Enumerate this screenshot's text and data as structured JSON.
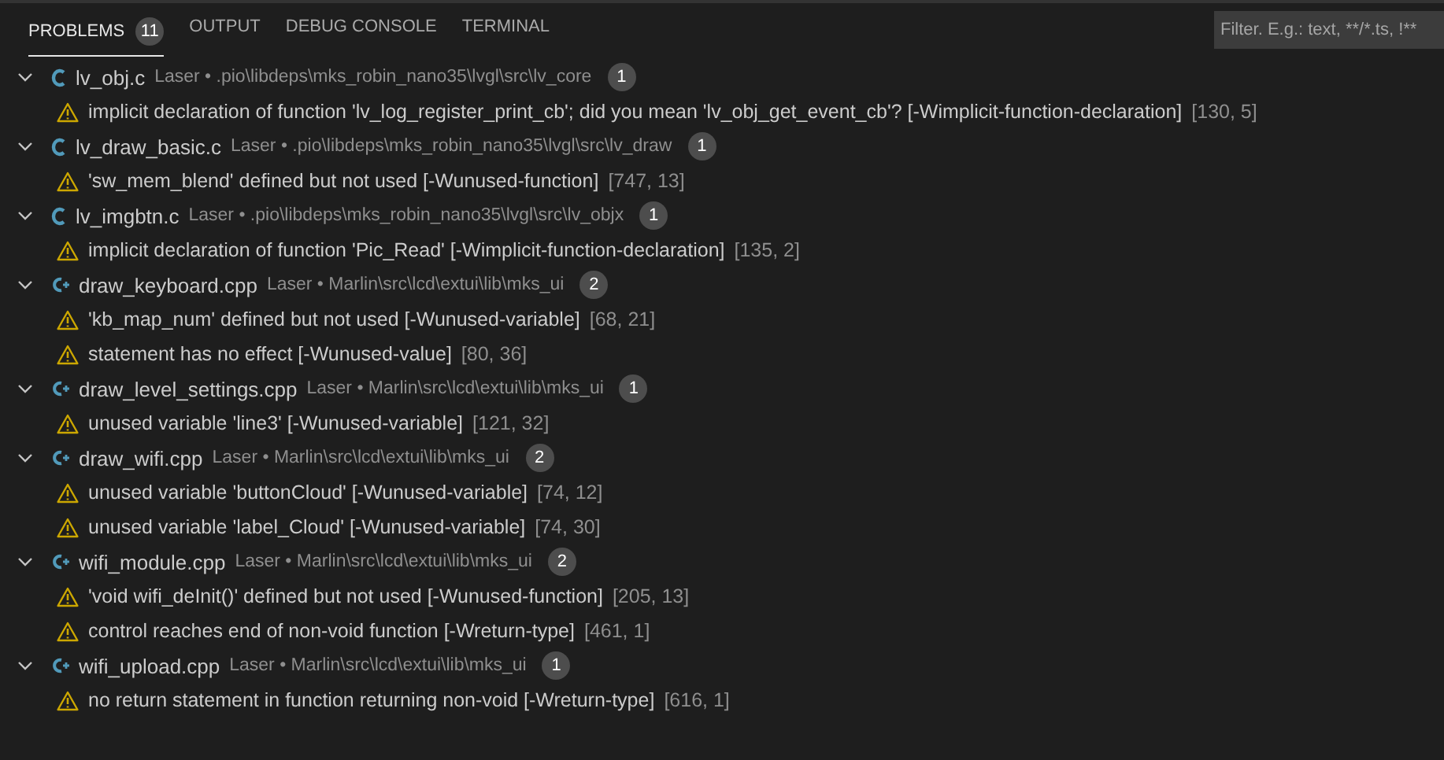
{
  "tabs": [
    {
      "label": "PROBLEMS",
      "badge": "11",
      "selected": true
    },
    {
      "label": "OUTPUT",
      "selected": false
    },
    {
      "label": "DEBUG CONSOLE",
      "selected": false
    },
    {
      "label": "TERMINAL",
      "selected": false
    }
  ],
  "filter": {
    "placeholder": "Filter. E.g.: text, **/*.ts, !**"
  },
  "files": [
    {
      "kind": "c",
      "name": "lv_obj.c",
      "path": "Laser • .pio\\libdeps\\mks_robin_nano35\\lvgl\\src\\lv_core",
      "count": "1",
      "expanded": true,
      "problems": [
        {
          "message": "implicit declaration of function 'lv_log_register_print_cb'; did you mean 'lv_obj_get_event_cb'? [-Wimplicit-function-declaration]",
          "position": "[130, 5]"
        }
      ]
    },
    {
      "kind": "c",
      "name": "lv_draw_basic.c",
      "path": "Laser • .pio\\libdeps\\mks_robin_nano35\\lvgl\\src\\lv_draw",
      "count": "1",
      "expanded": true,
      "problems": [
        {
          "message": "'sw_mem_blend' defined but not used [-Wunused-function]",
          "position": "[747, 13]"
        }
      ]
    },
    {
      "kind": "c",
      "name": "lv_imgbtn.c",
      "path": "Laser • .pio\\libdeps\\mks_robin_nano35\\lvgl\\src\\lv_objx",
      "count": "1",
      "expanded": true,
      "problems": [
        {
          "message": "implicit declaration of function 'Pic_Read' [-Wimplicit-function-declaration]",
          "position": "[135, 2]"
        }
      ]
    },
    {
      "kind": "cpp",
      "name": "draw_keyboard.cpp",
      "path": "Laser • Marlin\\src\\lcd\\extui\\lib\\mks_ui",
      "count": "2",
      "expanded": true,
      "problems": [
        {
          "message": "'kb_map_num' defined but not used [-Wunused-variable]",
          "position": "[68, 21]"
        },
        {
          "message": "statement has no effect [-Wunused-value]",
          "position": "[80, 36]"
        }
      ]
    },
    {
      "kind": "cpp",
      "name": "draw_level_settings.cpp",
      "path": "Laser • Marlin\\src\\lcd\\extui\\lib\\mks_ui",
      "count": "1",
      "expanded": true,
      "problems": [
        {
          "message": "unused variable 'line3' [-Wunused-variable]",
          "position": "[121, 32]"
        }
      ]
    },
    {
      "kind": "cpp",
      "name": "draw_wifi.cpp",
      "path": "Laser • Marlin\\src\\lcd\\extui\\lib\\mks_ui",
      "count": "2",
      "expanded": true,
      "problems": [
        {
          "message": "unused variable 'buttonCloud' [-Wunused-variable]",
          "position": "[74, 12]"
        },
        {
          "message": "unused variable 'label_Cloud' [-Wunused-variable]",
          "position": "[74, 30]"
        }
      ]
    },
    {
      "kind": "cpp",
      "name": "wifi_module.cpp",
      "path": "Laser • Marlin\\src\\lcd\\extui\\lib\\mks_ui",
      "count": "2",
      "expanded": true,
      "problems": [
        {
          "message": "'void wifi_deInit()' defined but not used [-Wunused-function]",
          "position": "[205, 13]"
        },
        {
          "message": "control reaches end of non-void function [-Wreturn-type]",
          "position": "[461, 1]"
        }
      ]
    },
    {
      "kind": "cpp",
      "name": "wifi_upload.cpp",
      "path": "Laser • Marlin\\src\\lcd\\extui\\lib\\mks_ui",
      "count": "1",
      "expanded": true,
      "problems": [
        {
          "message": "no return statement in function returning non-void [-Wreturn-type]",
          "position": "[616, 1]"
        }
      ]
    }
  ]
}
